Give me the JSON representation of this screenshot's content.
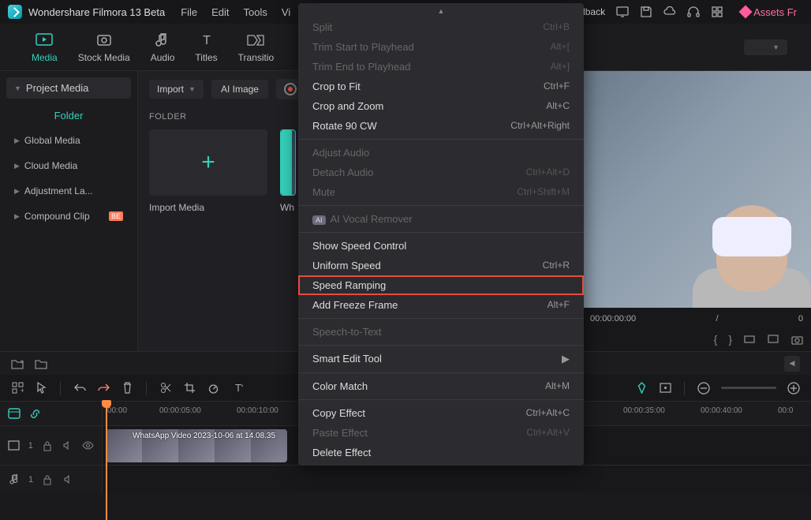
{
  "titlebar": {
    "app_name": "Wondershare Filmora 13 Beta",
    "menus": [
      "File",
      "Edit",
      "Tools",
      "Vi"
    ],
    "feedback": "dback",
    "assets": "Assets Fr"
  },
  "tabs": {
    "items": [
      {
        "label": "Media",
        "icon": "media-icon",
        "active": true
      },
      {
        "label": "Stock Media",
        "icon": "stock-icon"
      },
      {
        "label": "Audio",
        "icon": "audio-icon"
      },
      {
        "label": "Titles",
        "icon": "titles-icon"
      },
      {
        "label": "Transitio",
        "icon": "transition-icon"
      }
    ]
  },
  "sidebar": {
    "project_media": "Project Media",
    "folder_label": "Folder",
    "items": [
      {
        "label": "Global Media"
      },
      {
        "label": "Cloud Media"
      },
      {
        "label": "Adjustment La..."
      },
      {
        "label": "Compound Clip",
        "badge": "BE"
      }
    ]
  },
  "center": {
    "import": "Import",
    "ai_image": "AI Image",
    "rec_label": "R",
    "folder_section": "FOLDER",
    "thumb1": "Import Media",
    "thumb2": "Wh"
  },
  "preview": {
    "time_current": "00:00:00:00",
    "slash": "/",
    "time_total": "0"
  },
  "timeline": {
    "ticks": [
      "00:00",
      "00:00:05:00",
      "00:00:10:00",
      "00:00:35:00",
      "00:00:40:00",
      "00:0"
    ],
    "clip_name": "WhatsApp Video 2023-10-06 at 14.08.35"
  },
  "context_menu": {
    "items": [
      {
        "label": "Split",
        "shortcut": "Ctrl+B",
        "disabled": true
      },
      {
        "label": "Trim Start to Playhead",
        "shortcut": "Alt+[",
        "disabled": true
      },
      {
        "label": "Trim End to Playhead",
        "shortcut": "Alt+]",
        "disabled": true
      },
      {
        "label": "Crop to Fit",
        "shortcut": "Ctrl+F"
      },
      {
        "label": "Crop and Zoom",
        "shortcut": "Alt+C"
      },
      {
        "label": "Rotate 90 CW",
        "shortcut": "Ctrl+Alt+Right"
      },
      {
        "sep": true
      },
      {
        "label": "Adjust Audio",
        "disabled": true
      },
      {
        "label": "Detach Audio",
        "shortcut": "Ctrl+Alt+D",
        "disabled": true
      },
      {
        "label": "Mute",
        "shortcut": "Ctrl+Shift+M",
        "disabled": true
      },
      {
        "sep": true
      },
      {
        "label": "AI Vocal Remover",
        "disabled": true,
        "ai_badge": true
      },
      {
        "sep": true
      },
      {
        "label": "Show Speed Control"
      },
      {
        "label": "Uniform Speed",
        "shortcut": "Ctrl+R"
      },
      {
        "label": "Speed Ramping",
        "highlight": true
      },
      {
        "label": "Add Freeze Frame",
        "shortcut": "Alt+F"
      },
      {
        "sep": true
      },
      {
        "label": "Speech-to-Text",
        "disabled": true
      },
      {
        "sep": true
      },
      {
        "label": "Smart Edit Tool",
        "submenu": true
      },
      {
        "sep": true
      },
      {
        "label": "Color Match",
        "shortcut": "Alt+M"
      },
      {
        "sep": true
      },
      {
        "label": "Copy Effect",
        "shortcut": "Ctrl+Alt+C"
      },
      {
        "label": "Paste Effect",
        "shortcut": "Ctrl+Alt+V",
        "disabled": true
      },
      {
        "label": "Delete Effect"
      }
    ]
  }
}
